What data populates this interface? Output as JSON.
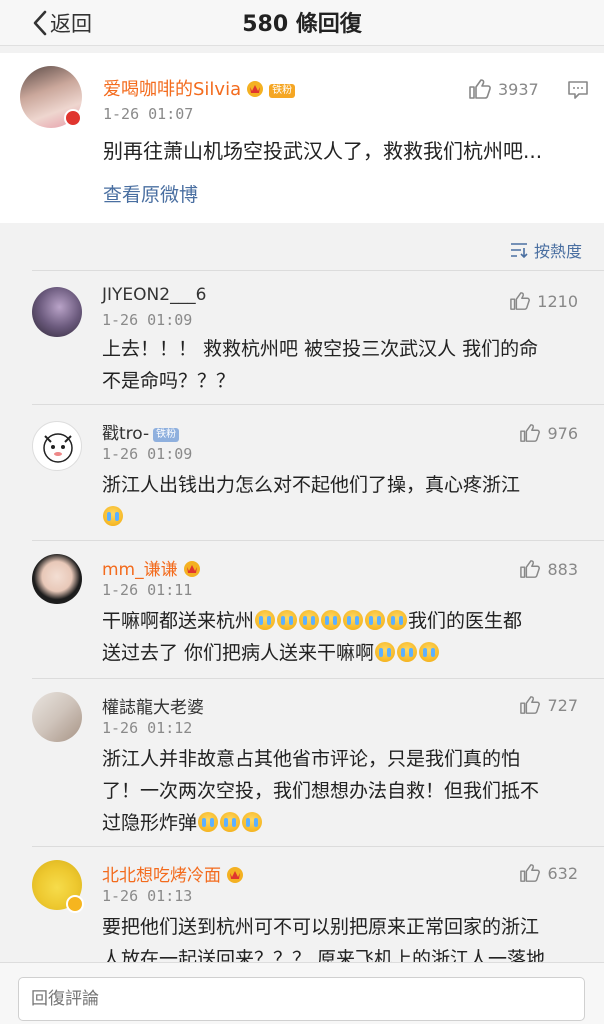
{
  "header": {
    "back_label": "返回",
    "title": "580 條回復"
  },
  "original": {
    "user": "爱喝咖啡的Silvia",
    "badge": "铁粉",
    "time": "1-26 01:07",
    "likes": "3937",
    "text": "别再往萧山机场空投武汉人了，救救我们杭州吧...",
    "view_link": "查看原微博"
  },
  "sort_label": "按熱度",
  "comments": [
    {
      "user": "JIYEON2___6",
      "time": "1-26 01:09",
      "likes": "1210",
      "line1": "上去！！！ 救救杭州吧 被空投三次武汉人 我们的命",
      "line2": "不是命吗？？？"
    },
    {
      "user": "戳tro-",
      "badge": "铁粉",
      "time": "1-26 01:09",
      "likes": "976",
      "line1": "浙江人出钱出力怎么对不起他们了操，真心疼浙江"
    },
    {
      "user": "mm_谦谦",
      "time": "1-26 01:11",
      "likes": "883",
      "line1a": "干嘛啊都送来杭州",
      "line1b": "我们的医生都",
      "line2": "送过去了  你们把病人送来干嘛啊"
    },
    {
      "user": "權誌龍大老婆",
      "time": "1-26 01:12",
      "likes": "727",
      "line1": "浙江人并非故意占其他省市评论，只是我们真的怕",
      "line2": "了！一次两次空投，我们想想办法自救！但我们抵不",
      "line3": "过隐形炸弹"
    },
    {
      "user": "北北想吃烤冷面",
      "time": "1-26 01:13",
      "likes": "632",
      "line1": "要把他们送到杭州可不可以别把原来正常回家的浙江",
      "line2": "人放在一起送回来？？？ 原来飞机上的浙江人一落地"
    }
  ],
  "reply": {
    "placeholder": "回復評論"
  },
  "colors": {
    "accent_link": "#4a6fa1",
    "username_orange": "#f36b1d",
    "verified_red": "#e0352f"
  },
  "icons": [
    "back-chevron-icon",
    "thumbs-up-icon",
    "comment-icon",
    "sort-icon",
    "crying-emoji-icon",
    "crown-badge-icon"
  ]
}
